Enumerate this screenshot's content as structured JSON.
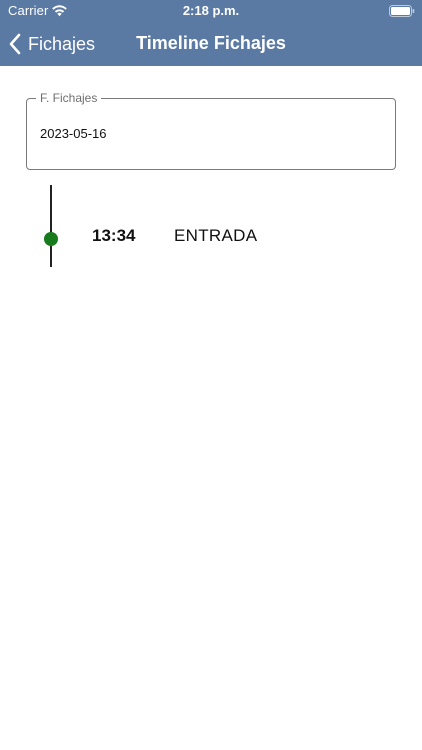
{
  "status_bar": {
    "carrier": "Carrier",
    "time": "2:18 p.m.",
    "icons": [
      "wifi-icon",
      "battery-icon"
    ]
  },
  "nav_bar": {
    "back_label": "Fichajes",
    "back_icon": "chevron-left-icon",
    "title": "Timeline Fichajes",
    "background_color": "#5a7aa3"
  },
  "date_field": {
    "label": "F. Fichajes",
    "value": "2023-05-16"
  },
  "timeline": {
    "dot_color": "#177a1d",
    "entries": [
      {
        "time": "13:34",
        "type": "ENTRADA"
      }
    ]
  }
}
